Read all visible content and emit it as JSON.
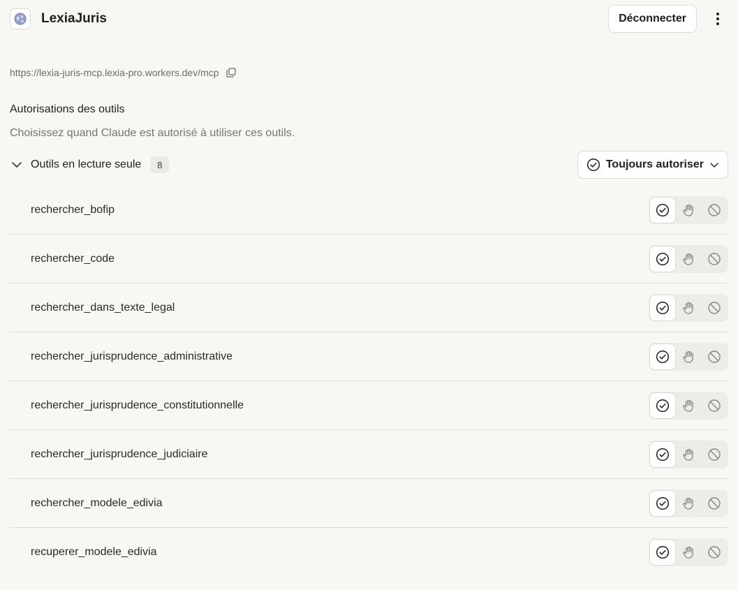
{
  "header": {
    "title": "LexiaJuris",
    "disconnect_label": "Déconnecter",
    "icon": "globe-icon",
    "more_icon": "more-vertical-icon"
  },
  "server": {
    "url": "https://lexia-juris-mcp.lexia-pro.workers.dev/mcp",
    "copy_icon": "copy-icon"
  },
  "permissions": {
    "title": "Autorisations des outils",
    "description": "Choisissez quand Claude est autorisé à utiliser ces outils."
  },
  "group": {
    "label": "Outils en lecture seule",
    "count": "8",
    "policy_label": "Toujours autoriser",
    "expanded": true
  },
  "tools": [
    {
      "name": "rechercher_bofip",
      "selected": "allow"
    },
    {
      "name": "rechercher_code",
      "selected": "allow"
    },
    {
      "name": "rechercher_dans_texte_legal",
      "selected": "allow"
    },
    {
      "name": "rechercher_jurisprudence_administrative",
      "selected": "allow"
    },
    {
      "name": "rechercher_jurisprudence_constitutionnelle",
      "selected": "allow"
    },
    {
      "name": "rechercher_jurisprudence_judiciaire",
      "selected": "allow"
    },
    {
      "name": "rechercher_modele_edivia",
      "selected": "allow"
    },
    {
      "name": "recuperer_modele_edivia",
      "selected": "allow"
    }
  ],
  "permission_options": [
    "check-circle-icon",
    "hand-icon",
    "block-icon"
  ],
  "colors": {
    "background": "#f8f7f4",
    "text": "#1f1e1c",
    "muted": "#77746e",
    "segment_bg": "#eeece7",
    "icon_inactive": "#8a8780"
  }
}
